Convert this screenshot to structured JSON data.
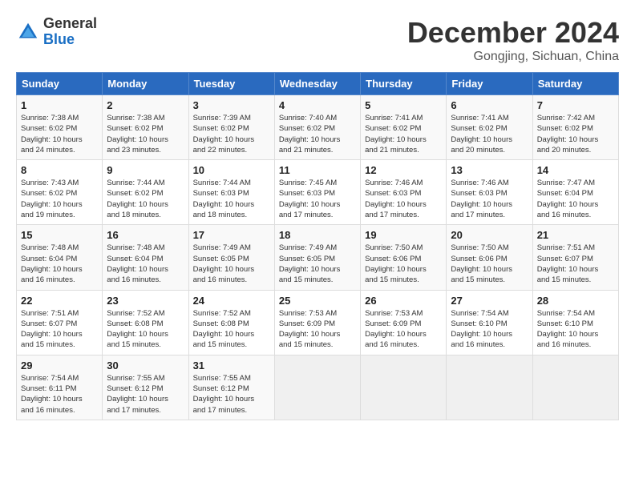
{
  "header": {
    "logo_general": "General",
    "logo_blue": "Blue",
    "month_title": "December 2024",
    "subtitle": "Gongjing, Sichuan, China"
  },
  "days_of_week": [
    "Sunday",
    "Monday",
    "Tuesday",
    "Wednesday",
    "Thursday",
    "Friday",
    "Saturday"
  ],
  "weeks": [
    [
      {
        "day": "1",
        "info": "Sunrise: 7:38 AM\nSunset: 6:02 PM\nDaylight: 10 hours\nand 24 minutes."
      },
      {
        "day": "2",
        "info": "Sunrise: 7:38 AM\nSunset: 6:02 PM\nDaylight: 10 hours\nand 23 minutes."
      },
      {
        "day": "3",
        "info": "Sunrise: 7:39 AM\nSunset: 6:02 PM\nDaylight: 10 hours\nand 22 minutes."
      },
      {
        "day": "4",
        "info": "Sunrise: 7:40 AM\nSunset: 6:02 PM\nDaylight: 10 hours\nand 21 minutes."
      },
      {
        "day": "5",
        "info": "Sunrise: 7:41 AM\nSunset: 6:02 PM\nDaylight: 10 hours\nand 21 minutes."
      },
      {
        "day": "6",
        "info": "Sunrise: 7:41 AM\nSunset: 6:02 PM\nDaylight: 10 hours\nand 20 minutes."
      },
      {
        "day": "7",
        "info": "Sunrise: 7:42 AM\nSunset: 6:02 PM\nDaylight: 10 hours\nand 20 minutes."
      }
    ],
    [
      {
        "day": "8",
        "info": "Sunrise: 7:43 AM\nSunset: 6:02 PM\nDaylight: 10 hours\nand 19 minutes."
      },
      {
        "day": "9",
        "info": "Sunrise: 7:44 AM\nSunset: 6:02 PM\nDaylight: 10 hours\nand 18 minutes."
      },
      {
        "day": "10",
        "info": "Sunrise: 7:44 AM\nSunset: 6:03 PM\nDaylight: 10 hours\nand 18 minutes."
      },
      {
        "day": "11",
        "info": "Sunrise: 7:45 AM\nSunset: 6:03 PM\nDaylight: 10 hours\nand 17 minutes."
      },
      {
        "day": "12",
        "info": "Sunrise: 7:46 AM\nSunset: 6:03 PM\nDaylight: 10 hours\nand 17 minutes."
      },
      {
        "day": "13",
        "info": "Sunrise: 7:46 AM\nSunset: 6:03 PM\nDaylight: 10 hours\nand 17 minutes."
      },
      {
        "day": "14",
        "info": "Sunrise: 7:47 AM\nSunset: 6:04 PM\nDaylight: 10 hours\nand 16 minutes."
      }
    ],
    [
      {
        "day": "15",
        "info": "Sunrise: 7:48 AM\nSunset: 6:04 PM\nDaylight: 10 hours\nand 16 minutes."
      },
      {
        "day": "16",
        "info": "Sunrise: 7:48 AM\nSunset: 6:04 PM\nDaylight: 10 hours\nand 16 minutes."
      },
      {
        "day": "17",
        "info": "Sunrise: 7:49 AM\nSunset: 6:05 PM\nDaylight: 10 hours\nand 16 minutes."
      },
      {
        "day": "18",
        "info": "Sunrise: 7:49 AM\nSunset: 6:05 PM\nDaylight: 10 hours\nand 15 minutes."
      },
      {
        "day": "19",
        "info": "Sunrise: 7:50 AM\nSunset: 6:06 PM\nDaylight: 10 hours\nand 15 minutes."
      },
      {
        "day": "20",
        "info": "Sunrise: 7:50 AM\nSunset: 6:06 PM\nDaylight: 10 hours\nand 15 minutes."
      },
      {
        "day": "21",
        "info": "Sunrise: 7:51 AM\nSunset: 6:07 PM\nDaylight: 10 hours\nand 15 minutes."
      }
    ],
    [
      {
        "day": "22",
        "info": "Sunrise: 7:51 AM\nSunset: 6:07 PM\nDaylight: 10 hours\nand 15 minutes."
      },
      {
        "day": "23",
        "info": "Sunrise: 7:52 AM\nSunset: 6:08 PM\nDaylight: 10 hours\nand 15 minutes."
      },
      {
        "day": "24",
        "info": "Sunrise: 7:52 AM\nSunset: 6:08 PM\nDaylight: 10 hours\nand 15 minutes."
      },
      {
        "day": "25",
        "info": "Sunrise: 7:53 AM\nSunset: 6:09 PM\nDaylight: 10 hours\nand 15 minutes."
      },
      {
        "day": "26",
        "info": "Sunrise: 7:53 AM\nSunset: 6:09 PM\nDaylight: 10 hours\nand 16 minutes."
      },
      {
        "day": "27",
        "info": "Sunrise: 7:54 AM\nSunset: 6:10 PM\nDaylight: 10 hours\nand 16 minutes."
      },
      {
        "day": "28",
        "info": "Sunrise: 7:54 AM\nSunset: 6:10 PM\nDaylight: 10 hours\nand 16 minutes."
      }
    ],
    [
      {
        "day": "29",
        "info": "Sunrise: 7:54 AM\nSunset: 6:11 PM\nDaylight: 10 hours\nand 16 minutes."
      },
      {
        "day": "30",
        "info": "Sunrise: 7:55 AM\nSunset: 6:12 PM\nDaylight: 10 hours\nand 17 minutes."
      },
      {
        "day": "31",
        "info": "Sunrise: 7:55 AM\nSunset: 6:12 PM\nDaylight: 10 hours\nand 17 minutes."
      },
      {
        "day": "",
        "info": ""
      },
      {
        "day": "",
        "info": ""
      },
      {
        "day": "",
        "info": ""
      },
      {
        "day": "",
        "info": ""
      }
    ]
  ]
}
